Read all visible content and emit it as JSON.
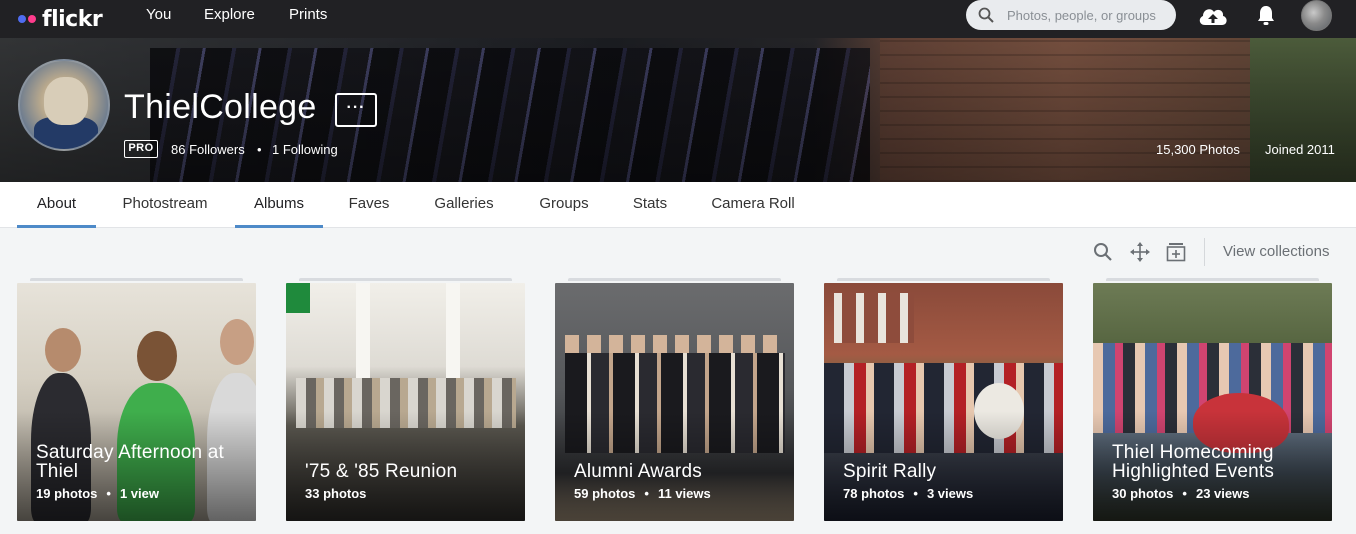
{
  "nav": {
    "logo": "flickr",
    "links": [
      "You",
      "Explore",
      "Prints"
    ],
    "search_placeholder": "Photos, people, or groups",
    "icons": [
      "search-icon",
      "upload-cloud-icon",
      "bell-icon",
      "avatar"
    ]
  },
  "profile": {
    "username": "ThielCollege",
    "more_label": "···",
    "pro_badge": "PRO",
    "followers": "86 Followers",
    "separator": "•",
    "following": "1 Following",
    "photos_count": "15,300 Photos",
    "joined": "Joined 2011"
  },
  "tabs": [
    {
      "label": "About"
    },
    {
      "label": "Photostream"
    },
    {
      "label": "Albums"
    },
    {
      "label": "Faves"
    },
    {
      "label": "Galleries"
    },
    {
      "label": "Groups"
    },
    {
      "label": "Stats"
    },
    {
      "label": "Camera Roll"
    }
  ],
  "toolbar": {
    "view_collections": "View collections",
    "icons": [
      "search-icon",
      "move-icon",
      "add-album-icon"
    ]
  },
  "albums": [
    {
      "title": "Saturday Afternoon at Thiel",
      "photos": "19 photos",
      "sep": "•",
      "views": "1 view"
    },
    {
      "title": "'75 & '85 Reunion",
      "photos": "33 photos",
      "sep": "",
      "views": ""
    },
    {
      "title": "Alumni Awards",
      "photos": "59 photos",
      "sep": "•",
      "views": "11 views"
    },
    {
      "title": "Spirit Rally",
      "photos": "78 photos",
      "sep": "•",
      "views": "3 views"
    },
    {
      "title": "Thiel Homecoming Highlighted Events",
      "photos": "30 photos",
      "sep": "•",
      "views": "23 views"
    }
  ],
  "colors": {
    "nav_bg": "#212124",
    "tab_underline": "#4e8ac8",
    "page_bg": "#f3f5f6",
    "logo_blue": "#4f6cf0",
    "logo_pink": "#ff3c8d"
  }
}
